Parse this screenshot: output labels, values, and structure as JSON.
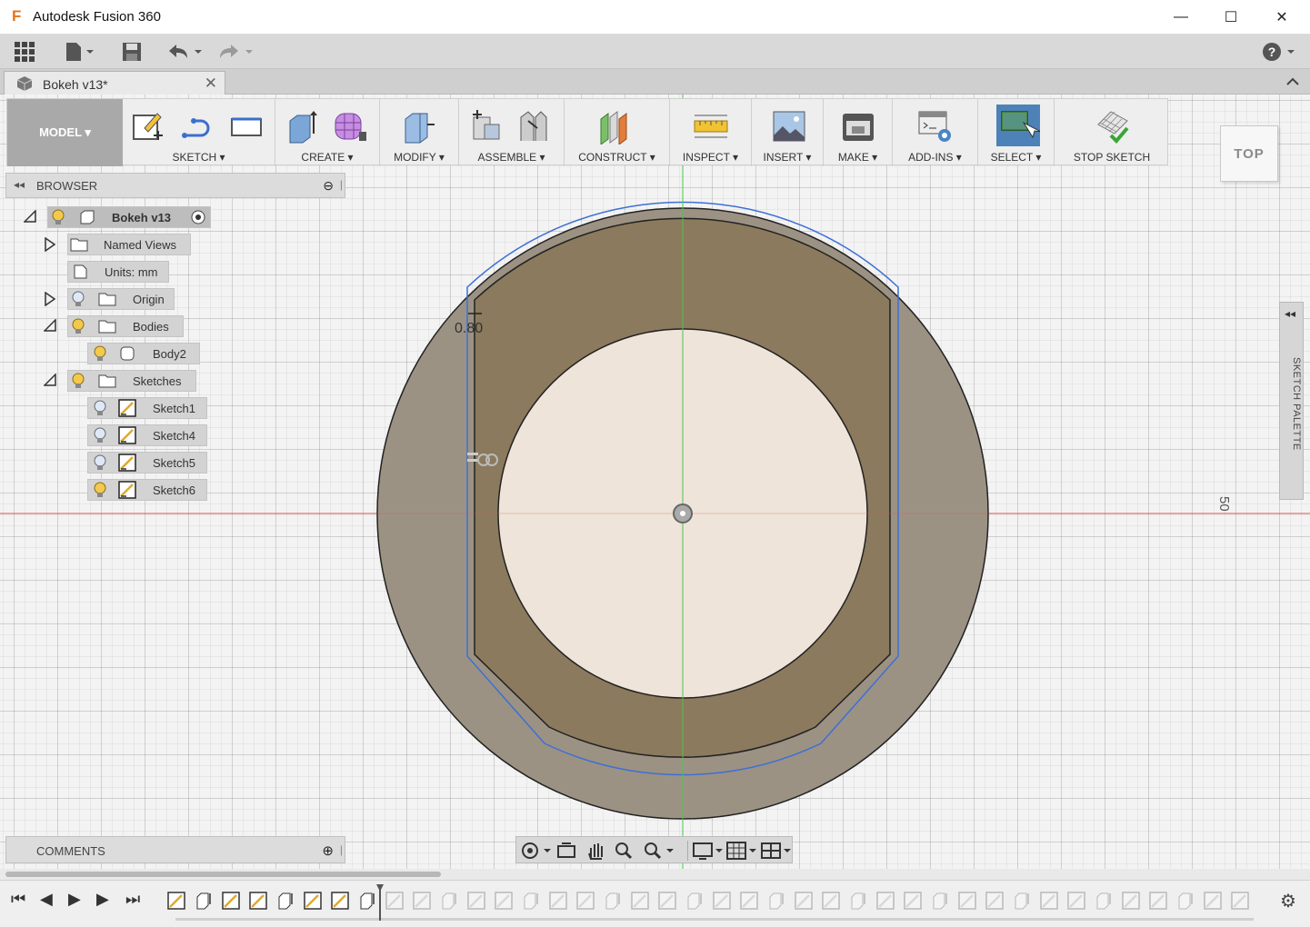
{
  "window": {
    "title": "Autodesk Fusion 360",
    "app_icon": "F",
    "minimize": "—",
    "maximize": "☐",
    "close": "✕"
  },
  "quick_access": {
    "help": "?"
  },
  "document_tab": {
    "label": "Bokeh v13*",
    "close": "✕"
  },
  "ribbon": {
    "workspace": "MODEL ▾",
    "groups": [
      {
        "label": "SKETCH ▾"
      },
      {
        "label": "CREATE ▾"
      },
      {
        "label": "MODIFY ▾"
      },
      {
        "label": "ASSEMBLE ▾"
      },
      {
        "label": "CONSTRUCT ▾"
      },
      {
        "label": "INSPECT ▾"
      },
      {
        "label": "INSERT ▾"
      },
      {
        "label": "MAKE ▾"
      },
      {
        "label": "ADD-INS ▾"
      },
      {
        "label": "SELECT ▾"
      },
      {
        "label": "STOP SKETCH"
      }
    ]
  },
  "viewcube": {
    "face": "TOP"
  },
  "browser": {
    "title": "BROWSER",
    "collapse_glyph": "◂◂",
    "minimize_glyph": "⊖",
    "pin_glyph": "|",
    "root": {
      "label": "Bokeh v13"
    },
    "named_views": {
      "label": "Named Views"
    },
    "units": {
      "label": "Units: mm"
    },
    "origin": {
      "label": "Origin"
    },
    "bodies": {
      "label": "Bodies",
      "children": [
        "Body2"
      ]
    },
    "sketches": {
      "label": "Sketches",
      "children": [
        "Sketch1",
        "Sketch4",
        "Sketch5",
        "Sketch6"
      ]
    }
  },
  "canvas": {
    "dimension_label": "0.80",
    "axis_label": "50",
    "colors": {
      "outer_body": "#9c9283",
      "inner_region": "#8b7a5d",
      "hole": "#efe4d9",
      "selection_outline": "#3d6fd6",
      "x_axis": "#e05050",
      "y_axis": "#4ec44e"
    }
  },
  "sketch_palette": {
    "label": "SKETCH PALETTE",
    "glyph": "◂◂"
  },
  "comments": {
    "title": "COMMENTS",
    "add_glyph": "⊕",
    "pin_glyph": "|"
  },
  "timeline": {
    "controls": [
      "⏮",
      "◀",
      "▶",
      "▶",
      "⏭"
    ],
    "item_count": 40,
    "active_count": 8
  }
}
